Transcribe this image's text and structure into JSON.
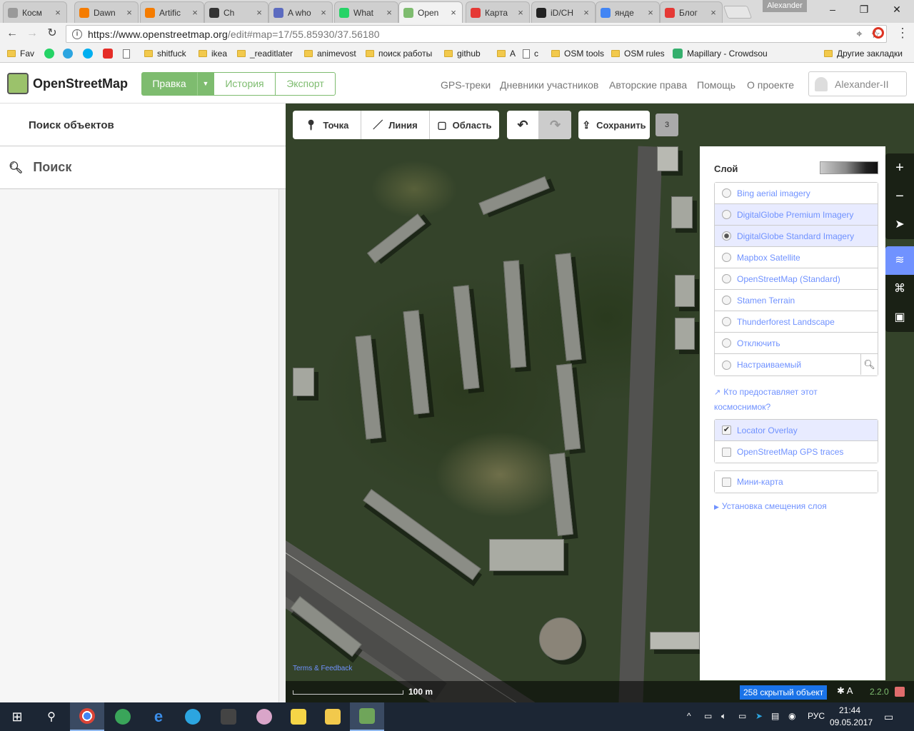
{
  "browser": {
    "tabs": [
      {
        "label": "Косм",
        "favicon_color": "#999999"
      },
      {
        "label": "Dawn",
        "favicon_color": "#f57c00"
      },
      {
        "label": "Artific",
        "favicon_color": "#f57c00"
      },
      {
        "label": "Ch",
        "favicon_color": "#333333"
      },
      {
        "label": "A who",
        "favicon_color": "#5c6bc0"
      },
      {
        "label": "What",
        "favicon_color": "#25d366"
      },
      {
        "label": "Open",
        "favicon_color": "#7ebc6f"
      },
      {
        "label": "Карта",
        "favicon_color": "#e53935"
      },
      {
        "label": "iD/CH",
        "favicon_color": "#222222"
      },
      {
        "label": "янде",
        "favicon_color": "#4285f4"
      },
      {
        "label": "Блог",
        "favicon_color": "#e53935"
      }
    ],
    "profile_name": "Alexander",
    "url_host": "https://www.openstreetmap.org",
    "url_path": "/edit#map=17/55.85930/37.56180",
    "bookmarks": [
      {
        "label": "Fav",
        "kind": "folder"
      },
      {
        "label": "",
        "kind": "whatsapp"
      },
      {
        "label": "",
        "kind": "telegram"
      },
      {
        "label": "",
        "kind": "skype"
      },
      {
        "label": "",
        "kind": "youtube"
      },
      {
        "label": "",
        "kind": "page"
      },
      {
        "label": "shitfuck",
        "kind": "folder"
      },
      {
        "label": "ikea",
        "kind": "folder"
      },
      {
        "label": "_readitlater",
        "kind": "folder"
      },
      {
        "label": "animevost",
        "kind": "folder"
      },
      {
        "label": "поиск работы",
        "kind": "folder"
      },
      {
        "label": "github",
        "kind": "folder"
      },
      {
        "label": "A",
        "kind": "folder"
      },
      {
        "label": "c",
        "kind": "page"
      },
      {
        "label": "OSM tools",
        "kind": "folder"
      },
      {
        "label": "OSM rules",
        "kind": "folder"
      },
      {
        "label": "Mapillary - Crowdsou",
        "kind": "mapillary"
      }
    ],
    "other_bookmarks": "Другие закладки"
  },
  "osm": {
    "logo": "OpenStreetMap",
    "edit_label": "Правка",
    "history_label": "История",
    "export_label": "Экспорт",
    "nav": [
      "GPS-треки",
      "Дневники участников",
      "Авторские права",
      "Помощь",
      "О проекте"
    ],
    "username": "Alexander-II"
  },
  "sidebar": {
    "title": "Поиск объектов",
    "search_placeholder": "Поиск"
  },
  "editor": {
    "point_label": "Точка",
    "line_label": "Линия",
    "area_label": "Область",
    "save_label": "Сохранить",
    "save_count": "3"
  },
  "layers": {
    "title": "Слой",
    "imagery": [
      {
        "label": "Bing aerial imagery",
        "selected": false,
        "highlight": false
      },
      {
        "label": "DigitalGlobe Premium Imagery",
        "selected": false,
        "highlight": true
      },
      {
        "label": "DigitalGlobe Standard Imagery",
        "selected": true,
        "highlight": true
      },
      {
        "label": "Mapbox Satellite",
        "selected": false,
        "highlight": false
      },
      {
        "label": "OpenStreetMap (Standard)",
        "selected": false,
        "highlight": false
      },
      {
        "label": "Stamen Terrain",
        "selected": false,
        "highlight": false
      },
      {
        "label": "Thunderforest Landscape",
        "selected": false,
        "highlight": false
      },
      {
        "label": "Отключить",
        "selected": false,
        "highlight": false
      },
      {
        "label": "Настраиваемый",
        "selected": false,
        "highlight": false
      }
    ],
    "attribution_link": "Кто предоставляет этот космоснимок?",
    "overlays": [
      {
        "label": "Locator Overlay",
        "checked": true
      },
      {
        "label": "OpenStreetMap GPS traces",
        "checked": false
      }
    ],
    "minimap": {
      "label": "Мини-карта",
      "checked": false
    },
    "offset_link": "Установка смещения слоя"
  },
  "map": {
    "terms": "Terms & Feedback",
    "scale": "100 m",
    "hidden_features": "258 скрытый объект",
    "version": "2.2.0"
  },
  "taskbar": {
    "lang": "РУС",
    "time": "21:44",
    "date": "09.05.2017"
  }
}
